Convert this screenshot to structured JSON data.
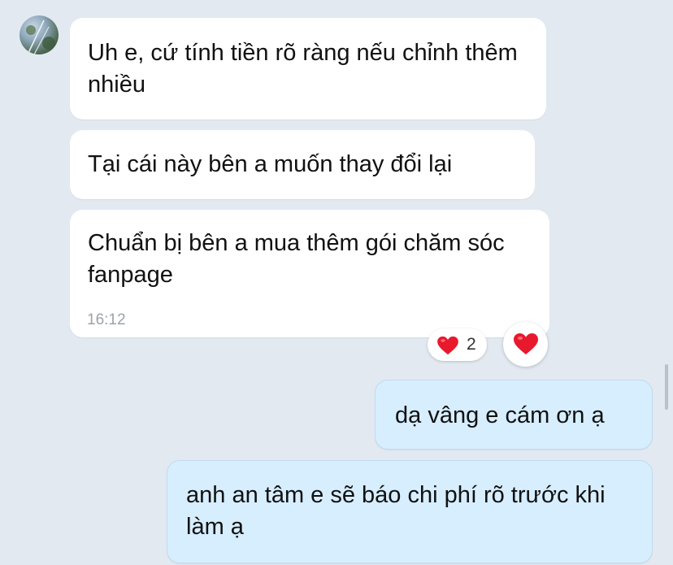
{
  "conversation": {
    "messages_in": [
      {
        "text": "Uh e, cứ tính tiền rõ ràng nếu chỉnh thêm nhiều"
      },
      {
        "text": "Tại cái này bên a muốn thay đổi lại"
      },
      {
        "text": "Chuẩn bị bên a mua thêm gói chăm sóc fanpage",
        "time": "16:12"
      }
    ],
    "reaction": {
      "icon": "red-heart-icon",
      "count": "2"
    },
    "react_button_icon": "red-heart-icon",
    "messages_out": [
      {
        "text": "dạ vâng e cám ơn ạ"
      },
      {
        "text": "anh an tâm e sẽ báo chi phí rõ trước khi làm ạ"
      }
    ]
  },
  "colors": {
    "background": "#e2e9f1",
    "incoming_bubble": "#ffffff",
    "outgoing_bubble": "#d7eefe",
    "heart": "#e8192c"
  }
}
